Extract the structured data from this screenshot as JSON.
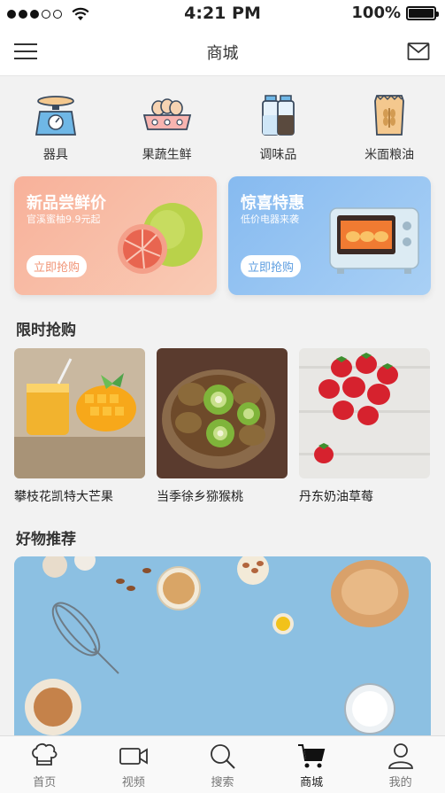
{
  "status_bar": {
    "time": "4:21 PM",
    "battery": "100%"
  },
  "nav": {
    "title": "商城"
  },
  "categories": [
    {
      "label": "器具",
      "icon": "scale-icon"
    },
    {
      "label": "果蔬生鲜",
      "icon": "eggs-icon"
    },
    {
      "label": "调味品",
      "icon": "salt-pepper-icon"
    },
    {
      "label": "米面粮油",
      "icon": "flour-bag-icon"
    }
  ],
  "promos": [
    {
      "title": "新品尝鲜价",
      "subtitle": "官溪蜜柚9.9元起",
      "button": "立即抢购",
      "color": "#f8b19a"
    },
    {
      "title": "惊喜特惠",
      "subtitle": "低价电器来袭",
      "button": "立即抢购",
      "color": "#86baf0"
    }
  ],
  "flash_sale": {
    "title": "限时抢购",
    "items": [
      {
        "name": "攀枝花凯特大芒果"
      },
      {
        "name": "当季徐乡猕猴桃"
      },
      {
        "name": "丹东奶油草莓"
      }
    ]
  },
  "recommend": {
    "title": "好物推荐"
  },
  "tabs": [
    {
      "label": "首页",
      "icon": "chef-hat-icon"
    },
    {
      "label": "视频",
      "icon": "video-camera-icon"
    },
    {
      "label": "搜索",
      "icon": "search-icon"
    },
    {
      "label": "商城",
      "icon": "cart-icon",
      "active": true
    },
    {
      "label": "我的",
      "icon": "user-icon"
    }
  ]
}
